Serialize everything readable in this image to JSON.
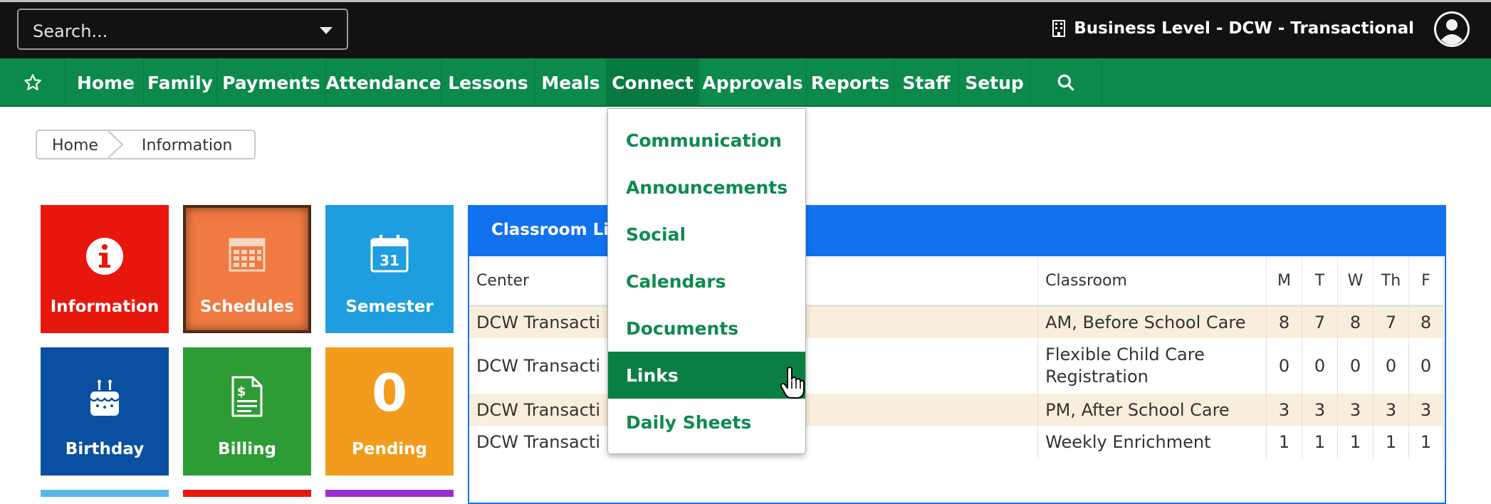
{
  "topbar": {
    "search_placeholder": "Search...",
    "business_level": "Business Level - DCW - Transactional"
  },
  "nav": {
    "items": [
      "Home",
      "Family",
      "Payments",
      "Attendance",
      "Lessons",
      "Meals",
      "Connect",
      "Approvals",
      "Reports",
      "Staff",
      "Setup"
    ],
    "active": "Connect"
  },
  "breadcrumb": [
    "Home",
    "Information"
  ],
  "tiles": [
    {
      "label": "Information",
      "color": "#e8170d",
      "icon": "info-icon"
    },
    {
      "label": "Schedules",
      "color": "#f07a41",
      "icon": "calendar-grid-icon"
    },
    {
      "label": "Semester",
      "color": "#1e9ee0",
      "icon": "calendar-31-icon",
      "icon_text": "31"
    },
    {
      "label": "Birthday",
      "color": "#0b4fa0",
      "icon": "cake-icon"
    },
    {
      "label": "Billing",
      "color": "#2e9c35",
      "icon": "invoice-icon"
    },
    {
      "label": "Pending",
      "color": "#f29c1d",
      "value": "0"
    }
  ],
  "panel": {
    "title": "Classroom List",
    "headers": [
      "Center",
      "Classroom",
      "M",
      "T",
      "W",
      "Th",
      "F"
    ],
    "rows": [
      {
        "center": "DCW Transacti",
        "classroom": "AM, Before School Care",
        "m": "8",
        "t": "7",
        "w": "8",
        "th": "7",
        "f": "8"
      },
      {
        "center": "DCW Transacti",
        "classroom": "Flexible Child Care Registration",
        "m": "0",
        "t": "0",
        "w": "0",
        "th": "0",
        "f": "0"
      },
      {
        "center": "DCW Transacti",
        "classroom": "PM, After School Care",
        "m": "3",
        "t": "3",
        "w": "3",
        "th": "3",
        "f": "3"
      },
      {
        "center": "DCW Transacti",
        "classroom": "Weekly Enrichment",
        "m": "1",
        "t": "1",
        "w": "1",
        "th": "1",
        "f": "1"
      }
    ]
  },
  "dropdown": {
    "items": [
      "Communication",
      "Announcements",
      "Social",
      "Calendars",
      "Documents",
      "Links",
      "Daily Sheets"
    ],
    "highlighted": "Links"
  },
  "colors": {
    "nav_green": "#0b8a4b",
    "panel_blue": "#1172ef",
    "topbar": "#121212"
  }
}
